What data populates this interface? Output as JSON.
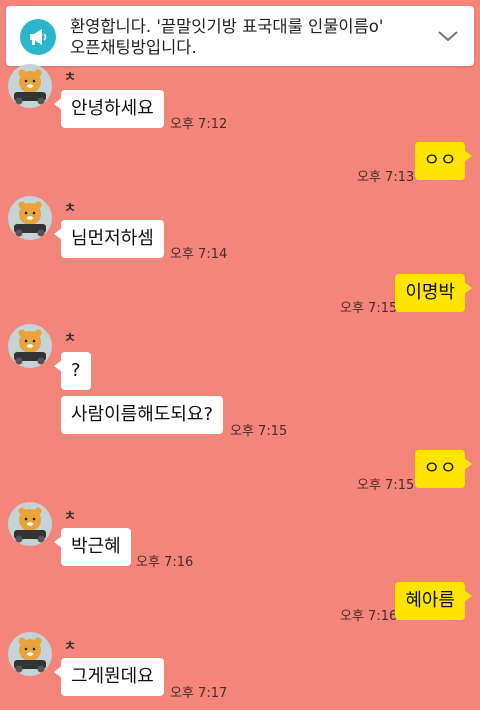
{
  "notice": {
    "line1": "환영합니다. '끝말잇기방 표국대룰 인물이름o'",
    "line2": "오픈채팅방입니다.",
    "icon": "megaphone-icon",
    "expand_icon": "chevron-down-icon"
  },
  "colors": {
    "background": "#f4857a",
    "incoming_bubble": "#ffffff",
    "outgoing_bubble": "#fee500",
    "notice_icon_bg": "#2bb6cc"
  },
  "sender_name": "ㅊ",
  "messages": [
    {
      "dir": "in",
      "text": "안녕하세요",
      "time": "오후 7:12"
    },
    {
      "dir": "out",
      "text": "ㅇㅇ",
      "time": "오후 7:13"
    },
    {
      "dir": "in",
      "text": "님먼저하셈",
      "time": "오후 7:14"
    },
    {
      "dir": "out",
      "text": "이명박",
      "time": "오후 7:15"
    },
    {
      "dir": "in",
      "text": "?",
      "time": ""
    },
    {
      "dir": "in",
      "text": "사람이름해도되요?",
      "time": "오후 7:15"
    },
    {
      "dir": "out",
      "text": "ㅇㅇ",
      "time": "오후 7:15"
    },
    {
      "dir": "in",
      "text": "박근혜",
      "time": "오후 7:16"
    },
    {
      "dir": "out",
      "text": "혜아름",
      "time": "오후 7:16"
    },
    {
      "dir": "in",
      "text": "그게뭔데요",
      "time": "오후 7:17"
    }
  ]
}
